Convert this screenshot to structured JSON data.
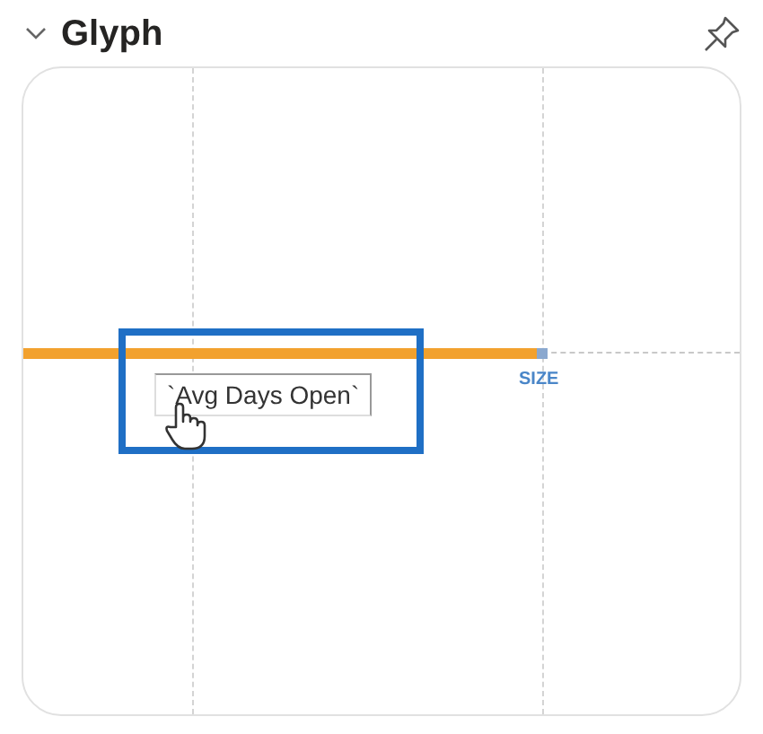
{
  "section": {
    "title": "Glyph",
    "expanded": true,
    "pinned": false
  },
  "glyph": {
    "axis_label": "SIZE",
    "drag_label": "`Avg Days Open`",
    "drop_target_highlighted": true
  }
}
